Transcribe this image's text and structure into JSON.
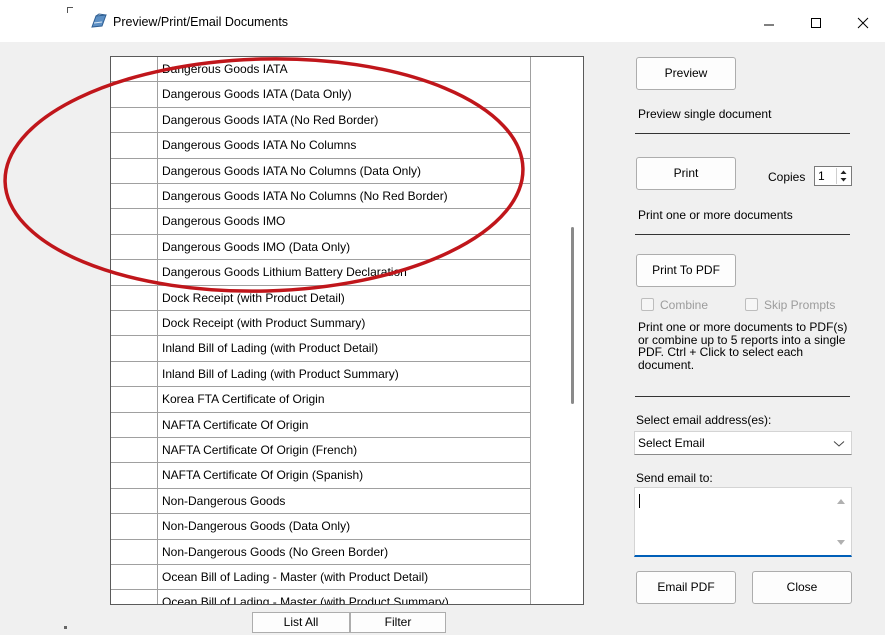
{
  "window": {
    "title": "Preview/Print/Email Documents"
  },
  "documents": [
    "Dangerous Goods IATA",
    "Dangerous Goods IATA (Data Only)",
    "Dangerous Goods IATA (No Red Border)",
    "Dangerous Goods IATA No Columns",
    "Dangerous Goods IATA No Columns (Data Only)",
    "Dangerous Goods IATA No Columns (No Red Border)",
    "Dangerous Goods IMO",
    "Dangerous Goods IMO (Data Only)",
    "Dangerous Goods Lithium Battery Declaration",
    "Dock Receipt (with Product Detail)",
    "Dock Receipt (with Product Summary)",
    "Inland Bill of Lading (with Product Detail)",
    "Inland Bill of Lading (with Product Summary)",
    "Korea FTA Certificate of Origin",
    "NAFTA Certificate Of Origin",
    "NAFTA Certificate Of Origin (French)",
    "NAFTA Certificate Of Origin (Spanish)",
    "Non-Dangerous Goods",
    "Non-Dangerous Goods (Data Only)",
    "Non-Dangerous Goods (No Green Border)",
    "Ocean Bill of Lading - Master (with Product Detail)",
    "Ocean Bill of Lading - Master (with Product Summary)"
  ],
  "list_buttons": {
    "list_all": "List All",
    "filter": "Filter"
  },
  "preview": {
    "button": "Preview",
    "description": "Preview single document"
  },
  "print": {
    "button": "Print",
    "copies_label": "Copies",
    "copies_value": "1",
    "description": "Print one or more documents"
  },
  "pdf": {
    "button": "Print To PDF",
    "combine_label": "Combine",
    "skip_prompts_label": "Skip Prompts",
    "description_lines": [
      "Print one or more documents to PDF(s)",
      "or combine up to 5 reports into a single",
      "PDF. Ctrl + Click to select each",
      "document."
    ]
  },
  "email": {
    "select_label": "Select email address(es):",
    "select_value": "Select Email",
    "send_to_label": "Send email to:",
    "send_to_value": ""
  },
  "bottom": {
    "email_pdf": "Email PDF",
    "close": "Close"
  },
  "colors": {
    "annotation_ellipse": "#c0161b",
    "focus_underline": "#005fb8"
  }
}
